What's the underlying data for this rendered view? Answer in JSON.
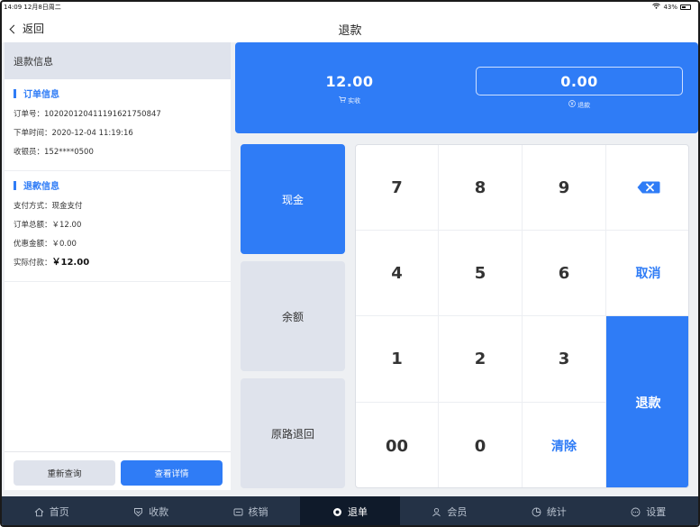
{
  "status": {
    "time": "14:09",
    "date": "12月8日周二",
    "battery": "43%"
  },
  "nav": {
    "back_label": "返回",
    "title": "退款"
  },
  "left": {
    "header": "退款信息",
    "order": {
      "title": "订单信息",
      "order_no": "订单号：102020120411191621750847",
      "order_time": "下单时间：2020-12-04 11:19:16",
      "cashier": "收银员：152****0500"
    },
    "refund": {
      "title": "退款信息",
      "pay_method": "支付方式：现金支付",
      "total_label": "订单总额：",
      "total": "￥12.00",
      "discount_label": "优惠金额：",
      "discount": "￥0.00",
      "paid_label": "实际付款：",
      "paid": "￥12.00"
    },
    "buttons": {
      "requery": "重新查询",
      "detail": "查看详情"
    }
  },
  "amounts": {
    "received": "12.00",
    "received_label": "实收",
    "refund": "0.00",
    "refund_label": "退款"
  },
  "pay_methods": [
    "现金",
    "余额",
    "原路退回"
  ],
  "keypad": {
    "k7": "7",
    "k8": "8",
    "k9": "9",
    "k4": "4",
    "k5": "5",
    "k6": "6",
    "k1": "1",
    "k2": "2",
    "k3": "3",
    "k00": "00",
    "k0": "0",
    "cancel": "取消",
    "clear": "清除",
    "refund": "退款",
    "delete_icon": "backspace-icon"
  },
  "tabs": [
    {
      "label": "首页",
      "icon": "home-icon"
    },
    {
      "label": "收款",
      "icon": "receive-icon"
    },
    {
      "label": "核销",
      "icon": "verify-icon"
    },
    {
      "label": "退单",
      "icon": "refund-icon",
      "active": true
    },
    {
      "label": "会员",
      "icon": "member-icon"
    },
    {
      "label": "统计",
      "icon": "stats-icon"
    },
    {
      "label": "设置",
      "icon": "settings-icon"
    }
  ],
  "colors": {
    "accent": "#2f7cf6",
    "tabbar": "#243246",
    "tab_active": "#0f1a2a",
    "idle_button": "#dfe3ec"
  }
}
